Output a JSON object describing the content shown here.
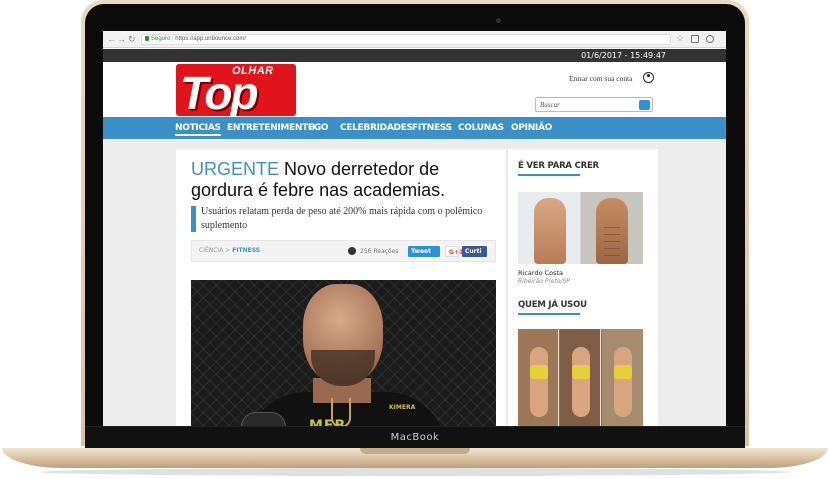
{
  "device": {
    "label": "MacBook"
  },
  "browser": {
    "secure_label": "Seguro",
    "url": "https://app.unbounce.com/"
  },
  "site": {
    "datetime": "01/6/2017 - 15:49:47",
    "logo": {
      "top": "Top",
      "olhar": "OLHAR"
    },
    "login_label": "Entrar com sua conta",
    "search_placeholder": "Buscar",
    "menu": [
      {
        "label": "NOTICIAS",
        "active": true
      },
      {
        "label": "ENTRETENIMENTO"
      },
      {
        "label": "EGO"
      },
      {
        "label": "CELEBRIDADES"
      },
      {
        "label": "FITNESS"
      },
      {
        "label": "COLUNAS"
      },
      {
        "label": "OPINIÃO"
      }
    ]
  },
  "article": {
    "tag": "URGENTE",
    "headline": " Novo derretedor de gordura é febre nas academias.",
    "subheadline": "Usuários relatam perda de peso até 200% mais rápida com o polêmico suplemento",
    "breadcrumb_prefix": "CIÊNCIA > ",
    "breadcrumb_current": "FITNESS",
    "reactions": "256 Reações",
    "share": {
      "tweet": "Tweet",
      "gplus": "G+1",
      "facebook": "Curti"
    },
    "photo_print": "MFB",
    "photo_badge": "KIMERA"
  },
  "sidebar": {
    "section1_title": "É VER PARA CRER",
    "testimonial_name": "Ricardo Costa",
    "testimonial_location": "Ribeirão Preto/SP",
    "section2_title": "QUEM JÁ USOU"
  },
  "colors": {
    "accent": "#3b91c7",
    "logo_red": "#e2141b",
    "date_bar": "#333333"
  }
}
